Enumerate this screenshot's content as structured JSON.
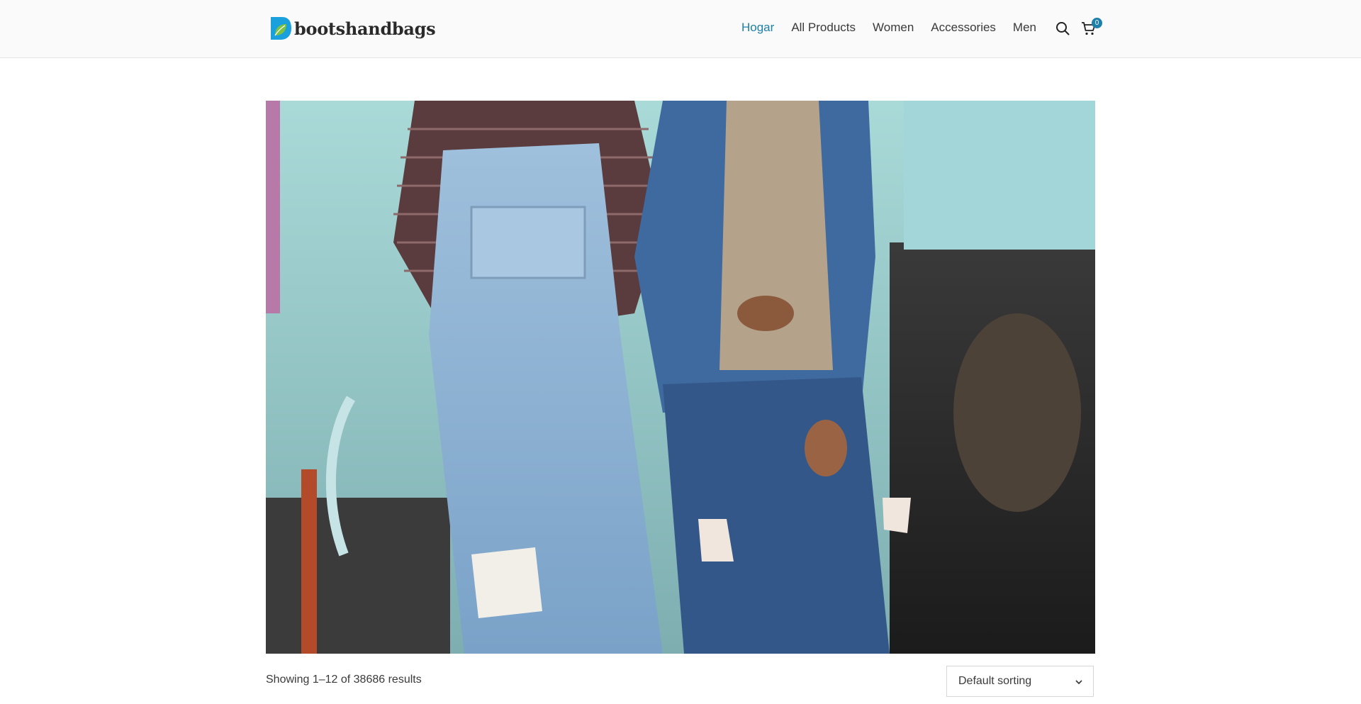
{
  "brand": {
    "name": "bootshandbags",
    "accent": "#1e80a8"
  },
  "nav": {
    "items": [
      {
        "label": "Hogar",
        "active": true
      },
      {
        "label": "All Products",
        "active": false
      },
      {
        "label": "Women",
        "active": false
      },
      {
        "label": "Accessories",
        "active": false
      },
      {
        "label": "Men",
        "active": false
      }
    ],
    "search_icon": "search-icon",
    "cart_icon": "cart-icon",
    "cart_count": "0"
  },
  "hero": {
    "image": "two women in denim overalls and denim jacket leaning on an old train car"
  },
  "shop": {
    "results_text": "Showing 1–12 of 38686 results",
    "sort_selected": "Default sorting"
  }
}
